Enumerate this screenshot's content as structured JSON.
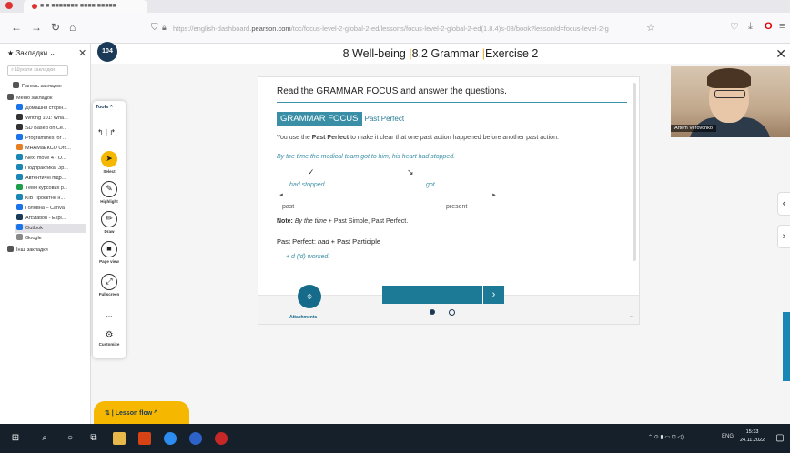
{
  "browser": {
    "tab_title": "■ ■ ■■■■■■■ ■■■■ ■■■■■",
    "url_prefix": "https://english-dashboard.",
    "url_domain": "pearson.com",
    "url_suffix": "/toc/focus-level-2-global-2-ed/lessons/focus-level-2-global-2-ed(1.8.4)s-08/book?lessonId=focus-level-2-g"
  },
  "bookmarks": {
    "header": "Закладки",
    "search_placeholder": "Шукати закладки",
    "items": [
      {
        "label": "Панель закладок",
        "color": "#555"
      },
      {
        "label": "Меню закладок",
        "color": "#555"
      },
      {
        "label": "Домашня сторін...",
        "color": "#1a73e8"
      },
      {
        "label": "Writing 101: Wha...",
        "color": "#333"
      },
      {
        "label": "SD Based on Ce...",
        "color": "#333"
      },
      {
        "label": "Programmes for ...",
        "color": "#1a73e8"
      },
      {
        "label": "МНАМаЕКСО Огс...",
        "color": "#e67e22"
      },
      {
        "label": "Next move 4 - O...",
        "color": "#1a86b5"
      },
      {
        "label": "Подпрактика. Зр...",
        "color": "#1a86b5"
      },
      {
        "label": "Автентичні підр...",
        "color": "#1a86b5"
      },
      {
        "label": "Теми курсових р...",
        "color": "#1e9e4a"
      },
      {
        "label": "КІВ Проєктне н...",
        "color": "#1a86b5"
      },
      {
        "label": "Головна – Canva",
        "color": "#1a73e8"
      },
      {
        "label": "ArtStation - Expl...",
        "color": "#1b3a57"
      },
      {
        "label": "Outlook",
        "color": "#1a73e8"
      },
      {
        "label": "Google",
        "color": "#888"
      },
      {
        "label": "Інші закладки",
        "color": "#555"
      }
    ]
  },
  "app": {
    "badge": "104",
    "title_unit": "8 Well-being",
    "title_sep": "|",
    "title_section": "8.2 Grammar",
    "title_exercise": "Exercise 2"
  },
  "tools": {
    "header": "Tools ^",
    "items": [
      {
        "label": "Select",
        "glyph": "➤"
      },
      {
        "label": "Highlight",
        "glyph": "✎"
      },
      {
        "label": "Draw",
        "glyph": "✏"
      },
      {
        "label": "Page view",
        "glyph": "■"
      },
      {
        "label": "Fullscreen",
        "glyph": "⤢"
      },
      {
        "label": "Customize",
        "glyph": "⚙"
      }
    ],
    "more": "..."
  },
  "lesson": {
    "instruction": "Read the GRAMMAR FOCUS and answer the questions.",
    "focus_label": "GRAMMAR FOCUS",
    "focus_topic": "Past Perfect",
    "intro_a": "You use the ",
    "intro_b": "Past Perfect",
    "intro_c": " to make it clear that one past action happened before another past action.",
    "example": "By the time the medical team got to him, his heart had stopped.",
    "timeline": {
      "label_a": "had stopped",
      "label_b": "got",
      "left": "past",
      "right": "present"
    },
    "note_a": "Note: ",
    "note_b": "By the time",
    "note_c": " + Past Simple, Past Perfect.",
    "pp_a": "Past Perfect: ",
    "pp_b": "had",
    "pp_c": " + Past Participle",
    "bullet": "+       d ('d) worked.",
    "attachments": "Attachments"
  },
  "video": {
    "name": "Artem Verovchko"
  },
  "lesson_flow": "Lesson flow ^",
  "taskbar": {
    "lang": "ENG",
    "time": "15:33",
    "date": "24.11.2022"
  }
}
